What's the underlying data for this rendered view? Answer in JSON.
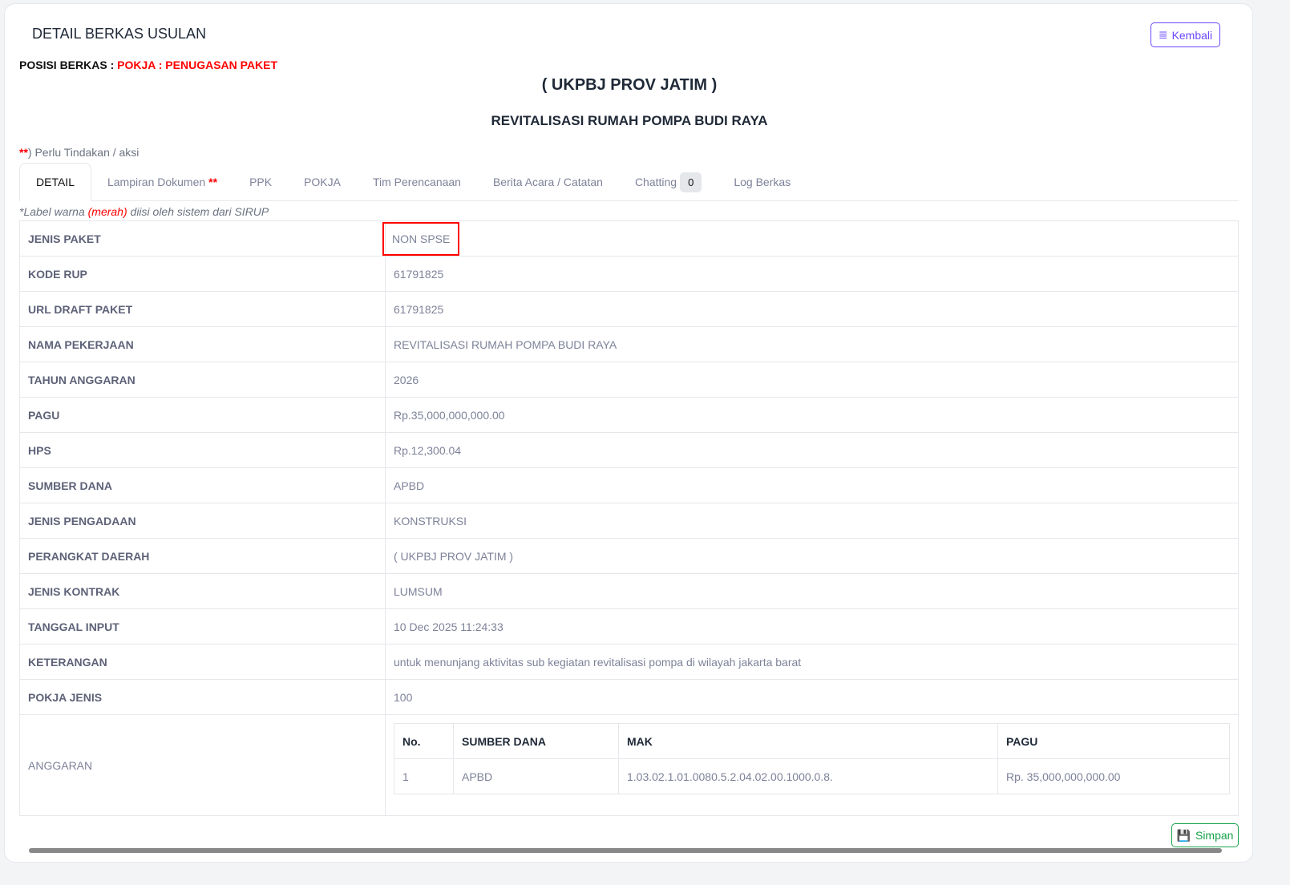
{
  "header": {
    "title": "DETAIL BERKAS USULAN",
    "back_label": "Kembali",
    "posisi_label": "POSISI BERKAS : ",
    "posisi_value": "POKJA : PENUGASAN PAKET"
  },
  "org": "( UKPBJ PROV JATIM )",
  "package_name": "REVITALISASI RUMAH POMPA BUDI RAYA",
  "note": {
    "stars": "**",
    "text": ") Perlu Tindakan / aksi"
  },
  "tabs": [
    {
      "label": "DETAIL"
    },
    {
      "label": "Lampiran Dokumen",
      "stars": "**"
    },
    {
      "label": "PPK"
    },
    {
      "label": "POKJA"
    },
    {
      "label": "Tim Perencanaan"
    },
    {
      "label": "Berita Acara / Catatan"
    },
    {
      "label": "Chatting",
      "count": "0"
    },
    {
      "label": "Log Berkas"
    }
  ],
  "legend": {
    "a": "*Label warna ",
    "b": "(merah)",
    "c": " diisi oleh sistem dari SIRUP"
  },
  "rows": [
    {
      "k": "JENIS PAKET",
      "v": "NON SPSE"
    },
    {
      "k": "KODE RUP",
      "v": "61791825"
    },
    {
      "k": "URL DRAFT PAKET",
      "v": "61791825"
    },
    {
      "k": "NAMA PEKERJAAN",
      "v": "REVITALISASI RUMAH POMPA BUDI RAYA"
    },
    {
      "k": "TAHUN ANGGARAN",
      "v": "2026"
    },
    {
      "k": "PAGU",
      "v": "Rp.35,000,000,000.00"
    },
    {
      "k": "HPS",
      "v": "Rp.12,300.04"
    },
    {
      "k": "SUMBER DANA",
      "v": "APBD"
    },
    {
      "k": "JENIS PENGADAAN",
      "v": "KONSTRUKSI"
    },
    {
      "k": "PERANGKAT DAERAH",
      "v": "( UKPBJ PROV JATIM )"
    },
    {
      "k": "JENIS KONTRAK",
      "v": "LUMSUM"
    },
    {
      "k": "TANGGAL INPUT",
      "v": "10 Dec 2025 11:24:33"
    },
    {
      "k": "KETERANGAN",
      "v": "untuk menunjang aktivitas sub kegiatan revitalisasi pompa di wilayah jakarta barat"
    },
    {
      "k": "POKJA JENIS",
      "v": "100"
    }
  ],
  "anggaran": {
    "label": "ANGGARAN",
    "headers": [
      "No.",
      "SUMBER DANA",
      "MAK",
      "PAGU"
    ],
    "rows": [
      [
        "1",
        "APBD",
        "1.03.02.1.01.0080.5.2.04.02.00.1000.0.8.",
        "Rp. 35,000,000,000.00"
      ]
    ]
  },
  "save_label": "Simpan"
}
